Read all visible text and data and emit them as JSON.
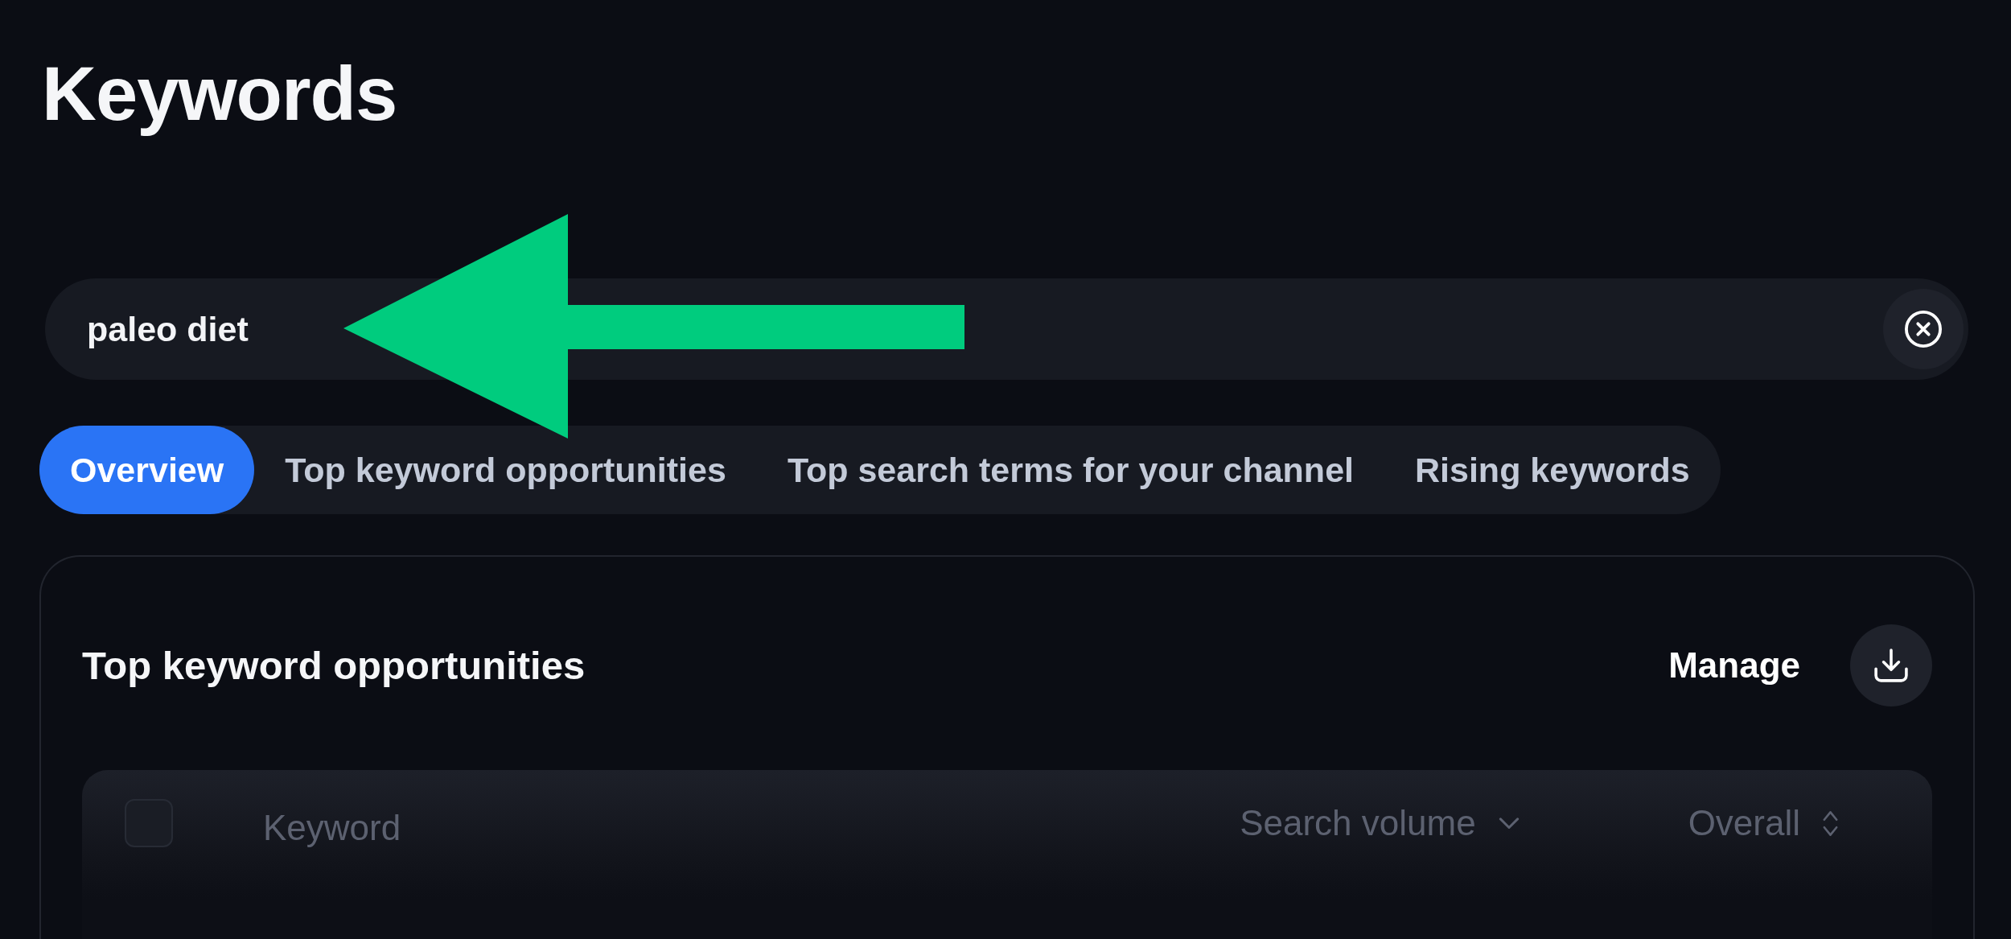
{
  "page": {
    "title": "Keywords"
  },
  "search": {
    "value": "paleo diet"
  },
  "annotations": [
    {
      "kind": "arrow"
    }
  ],
  "tabs": [
    {
      "label": "Overview",
      "selected": true
    },
    {
      "label": "Top keyword opportunities",
      "selected": false
    },
    {
      "label": "Top search terms for your channel",
      "selected": false
    },
    {
      "label": "Rising keywords",
      "selected": false
    }
  ],
  "card": {
    "title": "Top keyword opportunities",
    "manage_label": "Manage"
  },
  "table": {
    "select_all": {
      "checked": false
    },
    "columns": [
      {
        "label": "Keyword",
        "kind": "plain"
      },
      {
        "label": "Search volume",
        "kind": "sorted"
      },
      {
        "label": "Overall",
        "kind": "sortable"
      }
    ]
  }
}
